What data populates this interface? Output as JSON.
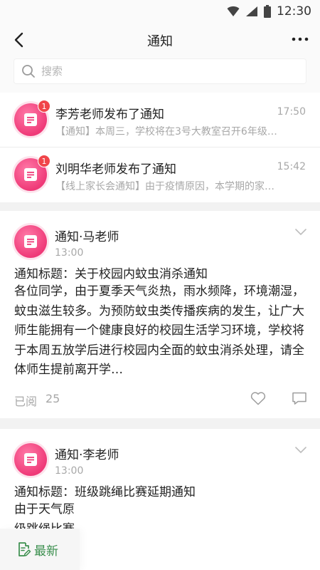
{
  "status_bar": {
    "time": "12:30"
  },
  "nav": {
    "title": "通知"
  },
  "search": {
    "placeholder": "搜索"
  },
  "chat_list": [
    {
      "name": "李芳老师发布了通知",
      "time": "17:50",
      "preview": "【通知】本周三，学校将在3号大教室召开6年级…",
      "badge": "1"
    },
    {
      "name": "刘明华老师发布了通知",
      "time": "15:42",
      "preview": "【线上家长会通知】由于疫情原因，本学期的家…",
      "badge": "1"
    }
  ],
  "notices": [
    {
      "author": "通知·马老师",
      "time": "13:00",
      "title": "通知标题：关于校园内蚊虫消杀通知",
      "body": "各位同学，由于夏季天气炎热，雨水频降，环境潮湿，蚊虫滋生较多。为预防蚊虫类传播疾病的发生，让广大师生能拥有一个健康良好的校园生活学习环境，学校将于本周五放学后进行校园内全面的蚊虫消杀处理，请全体师生提前离开学…",
      "read_label": "已阅",
      "read_count": "25"
    },
    {
      "author": "通知·李老师",
      "time": "13:00",
      "title": "通知标题：班级跳绳比赛延期通知",
      "body_line1": "由于天气原",
      "body_line2": "级跳绳比赛"
    }
  ],
  "bottom": {
    "latest_label": "最新"
  },
  "colors": {
    "accent_green": "#3b8f4e",
    "avatar_pink": "#ef3a78",
    "badge_red": "#f0454a"
  }
}
